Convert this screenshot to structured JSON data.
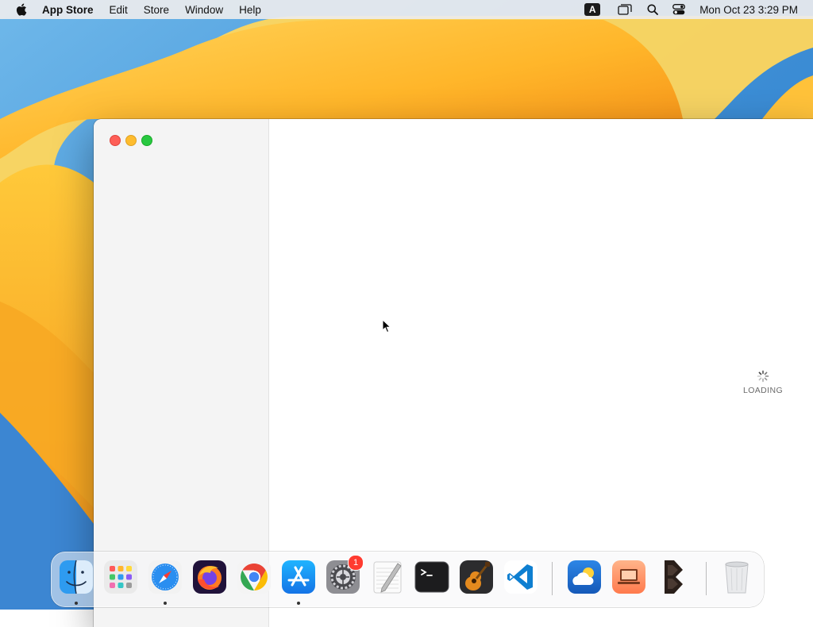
{
  "menubar": {
    "app_name": "App Store",
    "menus": [
      "Edit",
      "Store",
      "Window",
      "Help"
    ],
    "input_source": "A",
    "clock": "Mon Oct 23  3:29 PM",
    "icons": [
      "apple-icon",
      "input-source-icon",
      "screen-mirroring-icon",
      "spotlight-search-icon",
      "control-center-icon"
    ]
  },
  "window": {
    "app": "App Store",
    "loading_label": "LOADING",
    "traffic_lights": [
      "close",
      "minimize",
      "zoom"
    ]
  },
  "dock": {
    "apps": [
      {
        "name": "Finder",
        "running": true
      },
      {
        "name": "Launchpad",
        "running": false
      },
      {
        "name": "Safari",
        "running": true
      },
      {
        "name": "Firefox",
        "running": false
      },
      {
        "name": "Google Chrome",
        "running": false
      },
      {
        "name": "App Store",
        "running": true
      },
      {
        "name": "System Settings",
        "running": false,
        "badge": "1"
      },
      {
        "name": "TextEdit",
        "running": false
      },
      {
        "name": "Terminal",
        "running": false
      },
      {
        "name": "GarageBand",
        "running": false
      },
      {
        "name": "Visual Studio Code",
        "running": false
      },
      {
        "name": "Weather",
        "running": false
      },
      {
        "name": "Desktop App",
        "running": false
      },
      {
        "name": "BBEdit",
        "running": false
      },
      {
        "name": "Trash",
        "running": false
      }
    ]
  },
  "colors": {
    "close": "#fe5f57",
    "minimize": "#febc2e",
    "zoom": "#28c840",
    "badge": "#ff3b30"
  }
}
